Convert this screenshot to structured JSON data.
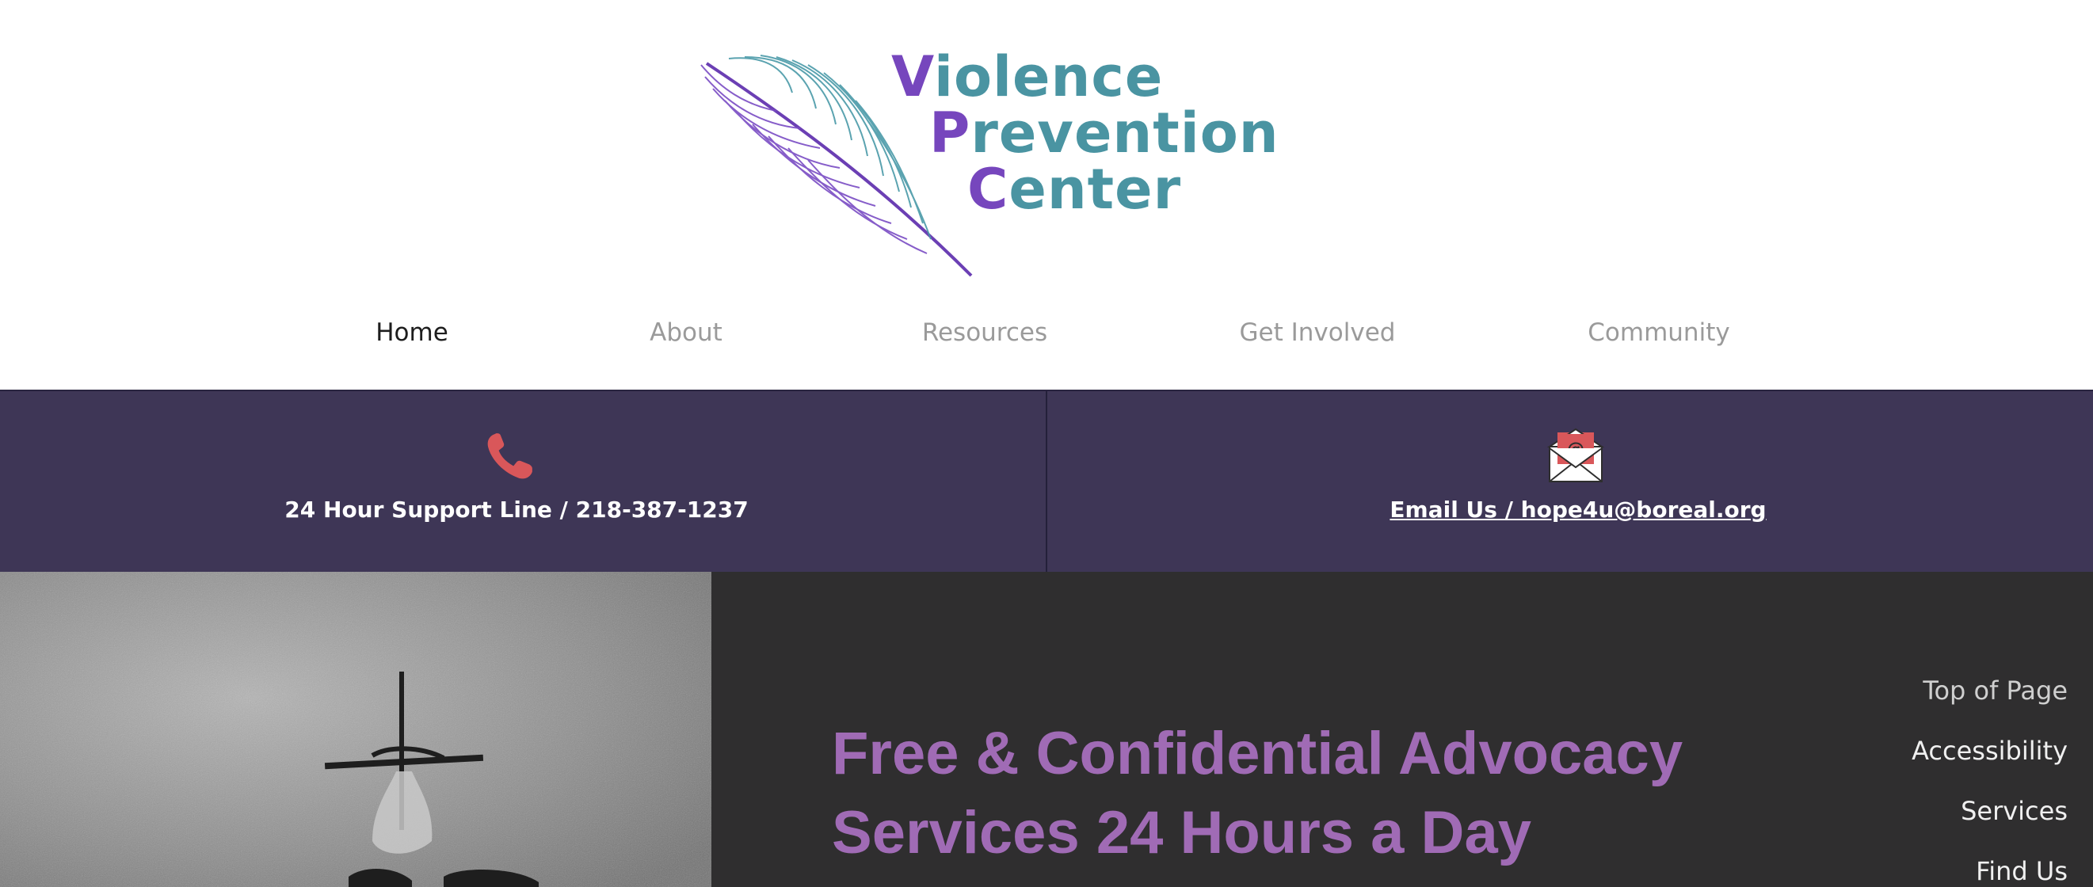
{
  "logo": {
    "line1": {
      "cap": "V",
      "rest": "iolence"
    },
    "line2": {
      "cap": "P",
      "rest": "revention"
    },
    "line3": {
      "cap": "C",
      "rest": "enter"
    },
    "icon": "feather-icon"
  },
  "nav": {
    "items": [
      {
        "label": "Home",
        "active": true
      },
      {
        "label": "About",
        "active": false
      },
      {
        "label": "Resources",
        "active": false
      },
      {
        "label": "Get Involved",
        "active": false
      },
      {
        "label": "Community",
        "active": false
      }
    ]
  },
  "contact": {
    "phone": {
      "icon": "phone-icon",
      "label": "24 Hour Support Line / 218-387-1237"
    },
    "email": {
      "icon": "email-envelope-icon",
      "label": "Email Us / hope4u@boreal.org"
    }
  },
  "hero": {
    "title_line1": "Free & Confidential Advocacy",
    "title_line2": "Services 24 Hours a Day"
  },
  "side_links": [
    {
      "label": "Top of Page"
    },
    {
      "label": "Accessibility"
    },
    {
      "label": "Services"
    },
    {
      "label": "Find Us"
    }
  ],
  "colors": {
    "brand_purple": "#7646bd",
    "brand_teal": "#4a94a2",
    "contact_band": "#3e3656",
    "hero_title": "#a06bb5",
    "icon_red": "#d9575a"
  }
}
